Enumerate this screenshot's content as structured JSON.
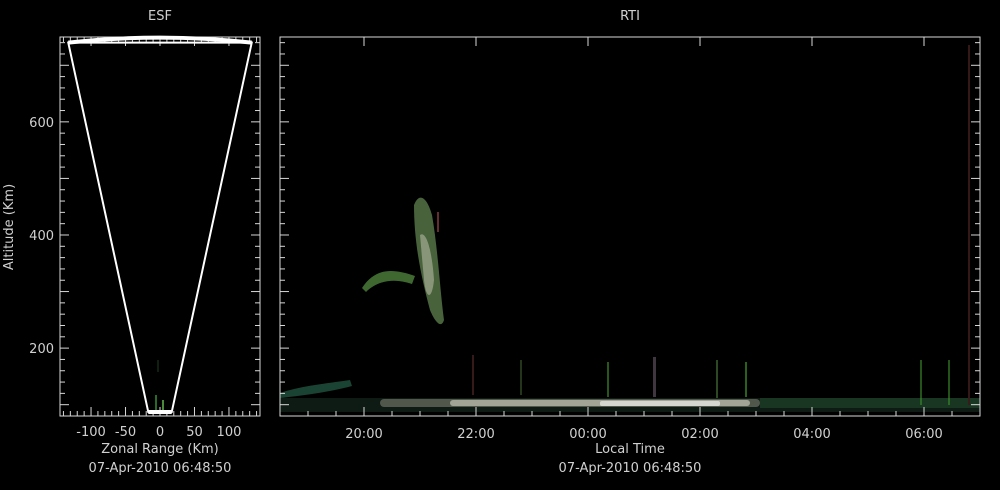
{
  "colors": {
    "background": "#000000",
    "axis": "#d8d8d8",
    "fan": "#ffffff"
  },
  "chart_data": [
    {
      "type": "area",
      "title": "ESF",
      "xlabel": "Zonal Range (Km)",
      "ylabel": "Altitude (Km)",
      "timestamp": "07-Apr-2010 06:48:50",
      "xlim": [
        -145,
        145
      ],
      "ylim": [
        80,
        750
      ],
      "x_ticks": [
        -100,
        -50,
        0,
        50,
        100
      ],
      "y_ticks": [
        200,
        400,
        600
      ],
      "fan": {
        "top_altitude": 740,
        "bottom_altitude": 87,
        "top_half_width": 133,
        "bottom_half_width": 17
      }
    },
    {
      "type": "heatmap",
      "title": "RTI",
      "xlabel": "Local Time",
      "ylabel": "Altitude (Km)",
      "timestamp": "07-Apr-2010 06:48:50",
      "xlim": [
        "18:30",
        "07:00"
      ],
      "ylim": [
        80,
        750
      ],
      "x_ticks": [
        "20:00",
        "22:00",
        "00:00",
        "02:00",
        "04:00",
        "06:00"
      ],
      "y_ticks": [
        200,
        400,
        600
      ]
    }
  ]
}
